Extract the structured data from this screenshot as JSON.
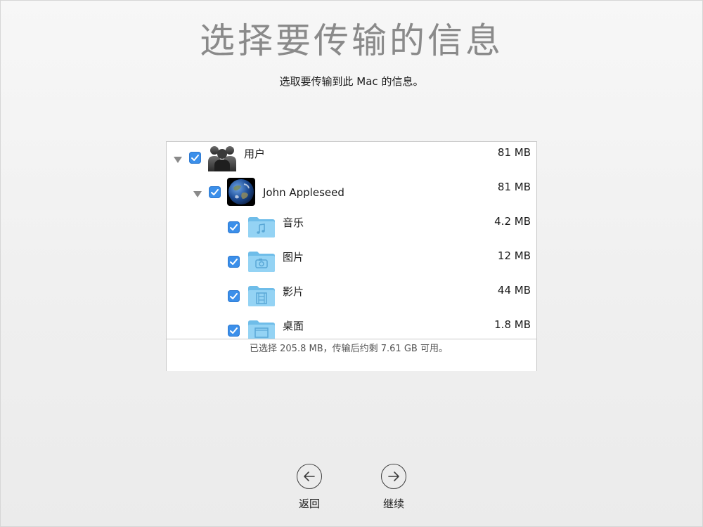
{
  "header": {
    "title": "选择要传输的信息",
    "subtitle": "选取要传输到此 Mac 的信息。"
  },
  "list": {
    "items": [
      {
        "label": "用户",
        "size": "81 MB",
        "checked": true,
        "icon": "users-group-icon"
      },
      {
        "label": "John Appleseed",
        "size": "81 MB",
        "checked": true,
        "icon": "earth-avatar-icon"
      },
      {
        "label": "音乐",
        "size": "4.2 MB",
        "checked": true,
        "icon": "music-folder-icon"
      },
      {
        "label": "图片",
        "size": "12 MB",
        "checked": true,
        "icon": "pictures-folder-icon"
      },
      {
        "label": "影片",
        "size": "44 MB",
        "checked": true,
        "icon": "movies-folder-icon"
      },
      {
        "label": "桌面",
        "size": "1.8 MB",
        "checked": true,
        "icon": "desktop-folder-icon"
      }
    ],
    "summary": "已选择 205.8 MB，传输后约剩 7.61 GB 可用。"
  },
  "nav": {
    "back_label": "返回",
    "continue_label": "继续"
  },
  "colors": {
    "checkbox": "#3b8fea",
    "folder": "#8ecdf1",
    "title": "#8a8a8a"
  }
}
